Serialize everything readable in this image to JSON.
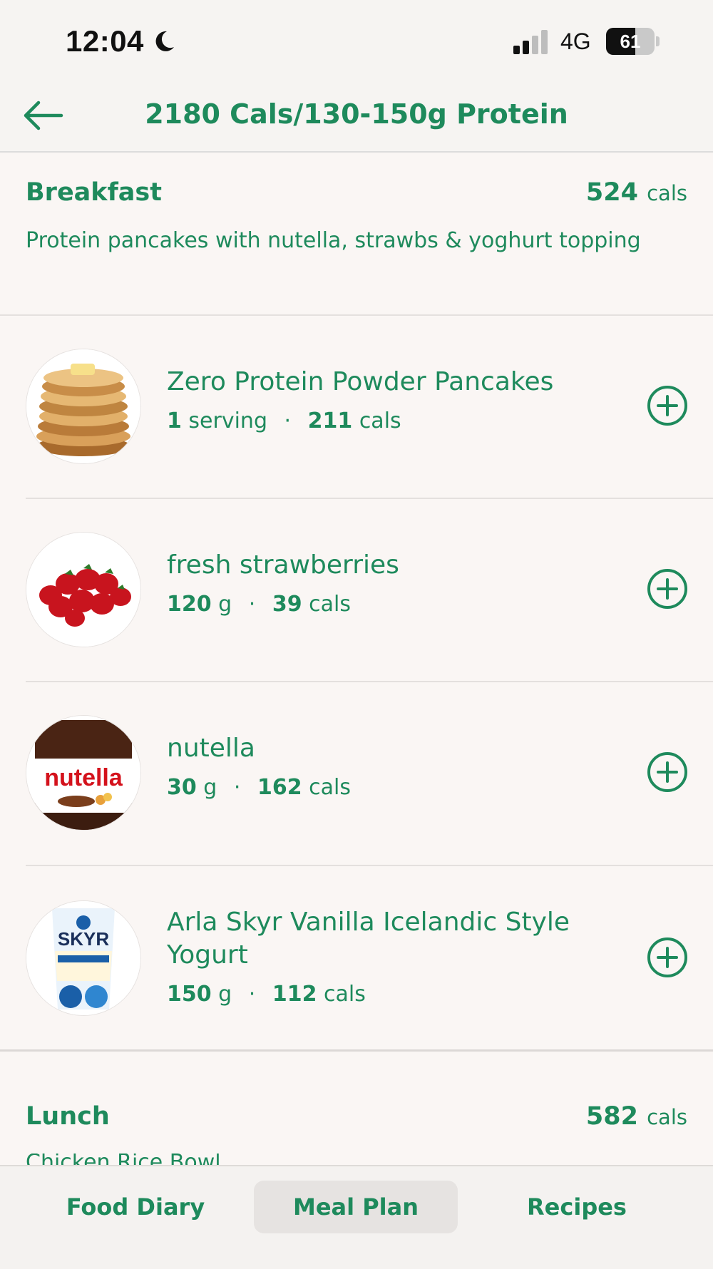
{
  "status_bar": {
    "time": "12:04",
    "network": "4G",
    "battery": "61",
    "battery_fraction": 0.61
  },
  "header": {
    "title": "2180 Cals/130-150g Protein",
    "back_icon": "arrow-left-icon"
  },
  "breakfast": {
    "name": "Breakfast",
    "cals": "524",
    "cals_unit": "cals",
    "description": "Protein pancakes with nutella, strawbs & yoghurt topping",
    "items": [
      {
        "name": "Zero Protein Powder Pancakes",
        "amount": "1",
        "unit": "serving",
        "cals": "211",
        "cals_unit": "cals",
        "image": "pancake-stack"
      },
      {
        "name": "fresh strawberries",
        "amount": "120",
        "unit": "g",
        "cals": "39",
        "cals_unit": "cals",
        "image": "strawberries"
      },
      {
        "name": "nutella",
        "amount": "30",
        "unit": "g",
        "cals": "162",
        "cals_unit": "cals",
        "image": "nutella-jar",
        "label_text": "nutella"
      },
      {
        "name": "Arla Skyr Vanilla Icelandic Style Yogurt",
        "amount": "150",
        "unit": "g",
        "cals": "112",
        "cals_unit": "cals",
        "image": "skyr-pot",
        "label_text": "SKYR"
      }
    ]
  },
  "lunch": {
    "name": "Lunch",
    "cals": "582",
    "cals_unit": "cals",
    "description_partial": "Chicken Rice Bowl"
  },
  "tabs": [
    {
      "label": "Food Diary",
      "active": false
    },
    {
      "label": "Meal Plan",
      "active": true
    },
    {
      "label": "Recipes",
      "active": false
    }
  ],
  "colors": {
    "accent": "#1e8a5c",
    "background": "#faf6f4"
  }
}
